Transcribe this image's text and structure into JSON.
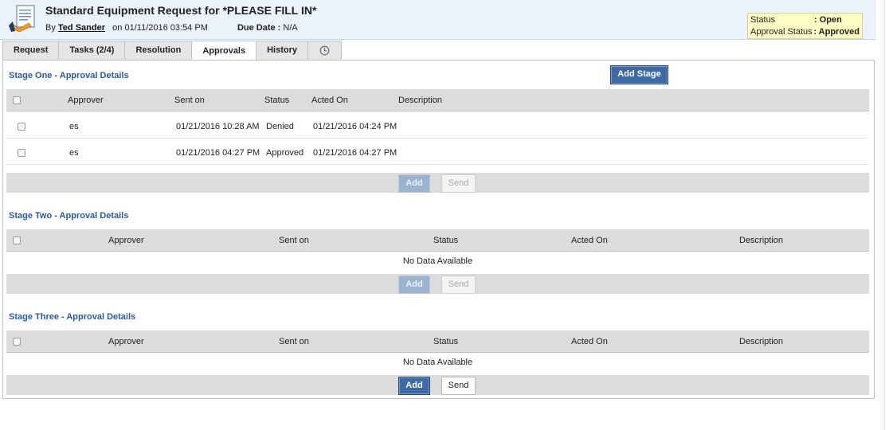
{
  "header": {
    "title": "Standard Equipment Request for *PLEASE FILL IN*",
    "by_label": "By",
    "author": "Ted Sander",
    "on_label": "on",
    "created": "01/11/2016 03:54 PM",
    "due_label": "Due Date :",
    "due_value": "N/A"
  },
  "status_box": {
    "status_label": "Status",
    "status_value": ": Open",
    "approval_label": "Approval Status",
    "approval_value": ": Approved"
  },
  "tabs": [
    {
      "label": "Request"
    },
    {
      "label": "Tasks (2/4)"
    },
    {
      "label": "Resolution"
    },
    {
      "label": "Approvals",
      "active": true
    },
    {
      "label": "History"
    },
    {
      "label": "",
      "icon": "clock-icon"
    }
  ],
  "add_stage_label": "Add Stage",
  "columns": {
    "approver": "Approver",
    "sent_on": "Sent on",
    "status": "Status",
    "acted_on": "Acted On",
    "description": "Description"
  },
  "stages": [
    {
      "title": "Stage One - Approval Details",
      "rows": [
        {
          "approver": "es",
          "sent_on": "01/21/2016 10:28 AM",
          "status": "Denied",
          "acted_on": "01/21/2016 04:24 PM",
          "description": ""
        },
        {
          "approver": "es",
          "sent_on": "01/21/2016 04:27 PM",
          "status": "Approved",
          "acted_on": "01/21/2016 04:27 PM",
          "description": ""
        }
      ],
      "add_label": "Add",
      "send_label": "Send"
    },
    {
      "title": "Stage Two - Approval Details",
      "no_data": "No Data Available",
      "add_label": "Add",
      "send_label": "Send"
    },
    {
      "title": "Stage Three - Approval Details",
      "no_data": "No Data Available",
      "add_label": "Add",
      "send_label": "Send"
    }
  ],
  "colors": {
    "accent": "#3d6aa3",
    "stage_title": "#2a5b96",
    "status_box_bg": "#fdfcc4"
  }
}
